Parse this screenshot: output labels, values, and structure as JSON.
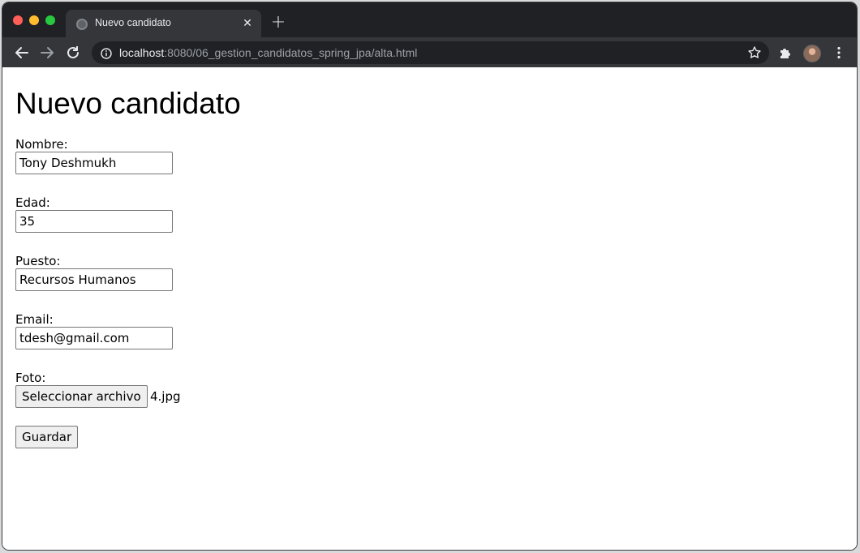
{
  "browser": {
    "tab_title": "Nuevo candidato",
    "url_host": "localhost",
    "url_path": ":8080/06_gestion_candidatos_spring_jpa/alta.html",
    "icons": [
      "back-icon",
      "forward-icon",
      "reload-icon",
      "info-icon",
      "star-icon",
      "extensions-icon",
      "menu-icon"
    ]
  },
  "page": {
    "title": "Nuevo candidato",
    "form": {
      "nombre_label": "Nombre:",
      "nombre_value": "Tony Deshmukh",
      "edad_label": "Edad:",
      "edad_value": "35",
      "puesto_label": "Puesto:",
      "puesto_value": "Recursos Humanos",
      "email_label": "Email:",
      "email_value": "tdesh@gmail.com",
      "foto_label": "Foto:",
      "file_button_label": "Seleccionar archivo",
      "file_name": "4.jpg",
      "submit_label": "Guardar"
    }
  }
}
